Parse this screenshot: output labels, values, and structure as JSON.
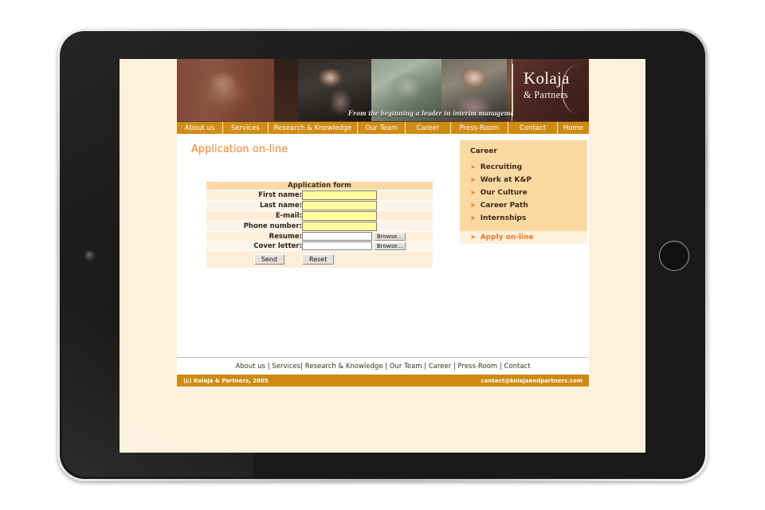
{
  "device": {
    "type": "tablet",
    "home_button": "home-button",
    "camera": "front-camera"
  },
  "site": {
    "banner": {
      "tagline": "From the beginning a leader in interim management",
      "logo_name": "Kolaja",
      "logo_sub": "& Partners"
    },
    "nav": [
      {
        "label": "About us"
      },
      {
        "label": "Services"
      },
      {
        "label": "Research & Knowledge"
      },
      {
        "label": "Our Team"
      },
      {
        "label": "Career"
      },
      {
        "label": "Press-Room"
      },
      {
        "label": "Contact"
      },
      {
        "label": "Home"
      }
    ],
    "page_title": "Application on-line",
    "form": {
      "heading": "Application form",
      "fields": [
        {
          "label": "First name:",
          "value": "",
          "type": "text"
        },
        {
          "label": "Last name:",
          "value": "",
          "type": "text"
        },
        {
          "label": "E-mail:",
          "value": "",
          "type": "text"
        },
        {
          "label": "Phone number:",
          "value": "",
          "type": "text"
        },
        {
          "label": "Resume:",
          "value": "",
          "type": "file"
        },
        {
          "label": "Cover letter:",
          "value": "",
          "type": "file"
        }
      ],
      "browse_label": "Browse...",
      "send_label": "Send",
      "reset_label": "Reset"
    },
    "sidebar": {
      "title": "Career",
      "items": [
        {
          "label": "Recruiting",
          "active": false
        },
        {
          "label": "Work at K&P",
          "active": false
        },
        {
          "label": "Our Culture",
          "active": false
        },
        {
          "label": "Career Path",
          "active": false
        },
        {
          "label": "Internships",
          "active": false
        },
        {
          "label": "Apply on-line",
          "active": true
        }
      ],
      "bullet": "➤"
    },
    "footer": {
      "links": [
        "About us",
        "Services|",
        "Research & Knowledge",
        "Our Team",
        "Career",
        "Press-Room",
        "Contact"
      ],
      "separator": "|",
      "copyright": "(c) Kolaja & Partners, 2005",
      "email": "contact@kolajaandpartners.com"
    }
  },
  "colors": {
    "nav_bar": "#cf8a12",
    "accent_orange": "#ef7a20",
    "sidebar_bg": "#fcd9a3",
    "page_bg": "#fdf1dd",
    "banner_brown": "#4a2620",
    "input_yellow": "#ffffa0"
  }
}
